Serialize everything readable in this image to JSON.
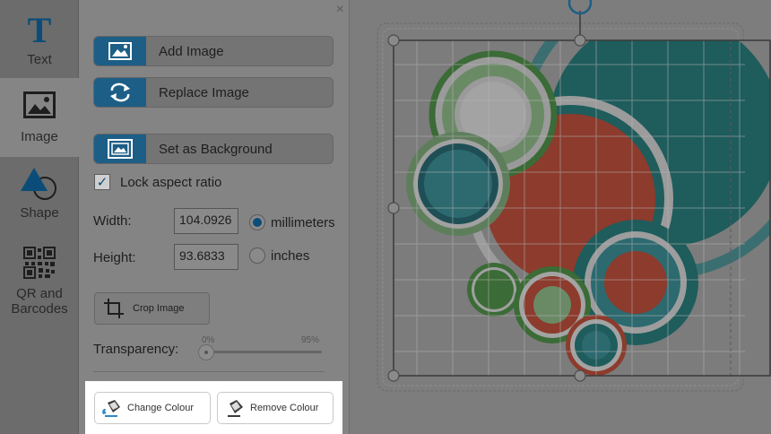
{
  "rail": {
    "items": [
      {
        "label": "Text",
        "icon": "text-icon"
      },
      {
        "label": "Image",
        "icon": "image-icon"
      },
      {
        "label": "Shape",
        "icon": "shape-icon"
      },
      {
        "label_line1": "QR and",
        "label_line2": "Barcodes",
        "icon": "qr-code-icon"
      }
    ],
    "active": "Image"
  },
  "panel": {
    "close": "×",
    "add_image": "Add Image",
    "replace_image": "Replace Image",
    "set_background": "Set as Background",
    "lock_aspect": "Lock aspect ratio",
    "lock_checked": true,
    "width_label": "Width:",
    "width_value": "104.0926",
    "height_label": "Height:",
    "height_value": "93.6833",
    "unit_mm": "millimeters",
    "unit_in": "inches",
    "selected_unit": "millimeters",
    "crop_image": "Crop Image",
    "transparency_label": "Transparency:",
    "transparency_min": "0%",
    "transparency_max": "95%",
    "transparency_value": 0,
    "change_colour": "Change Colour",
    "remove_colour": "Remove Colour"
  },
  "colors": {
    "accent_blue": "#1d5e86",
    "art_teal": "#1f5c5c",
    "art_red": "#8a3a2c",
    "art_green": "#3a6b36"
  }
}
